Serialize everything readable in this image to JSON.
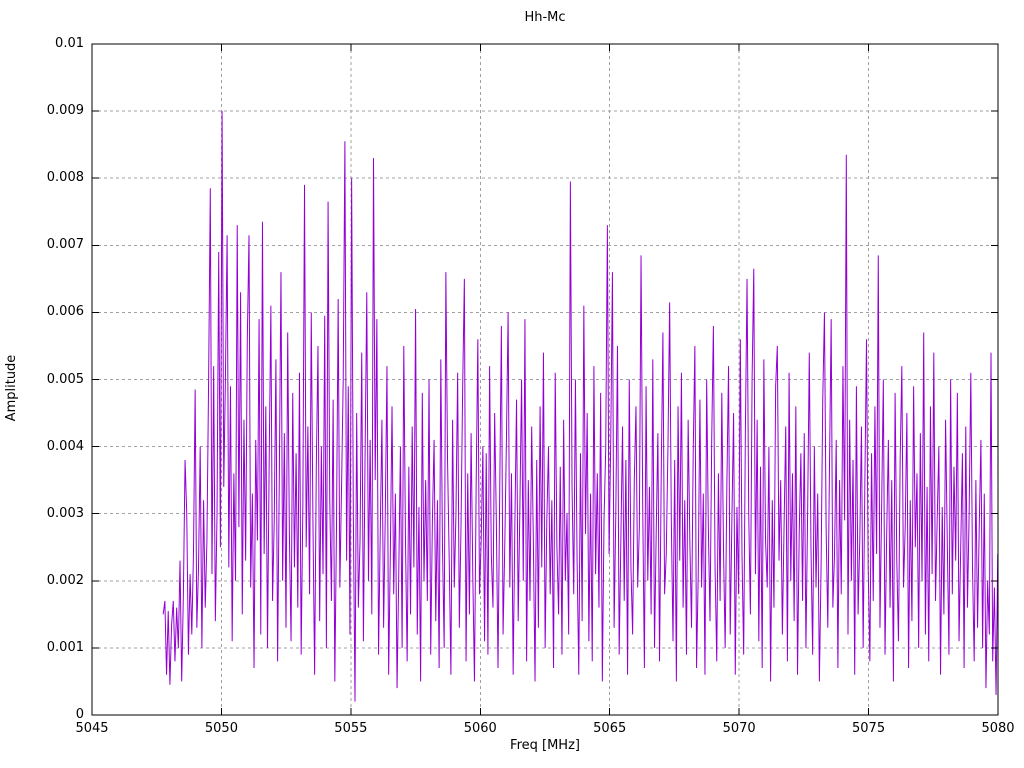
{
  "chart_data": {
    "type": "line",
    "title": "Hh-Mc",
    "xlabel": "Freq [MHz]",
    "ylabel": "Amplitude",
    "xlim": [
      5045,
      5080
    ],
    "ylim": [
      0,
      0.01
    ],
    "x_ticks": [
      5045,
      5050,
      5055,
      5060,
      5065,
      5070,
      5075,
      5080
    ],
    "x_tick_labels": [
      "5045",
      "5050",
      "5055",
      "5060",
      "5065",
      "5070",
      "5075",
      "5080"
    ],
    "y_ticks": [
      0,
      0.001,
      0.002,
      0.003,
      0.004,
      0.005,
      0.006,
      0.007,
      0.008,
      0.009,
      0.01
    ],
    "y_tick_labels": [
      "0",
      "0.001",
      "0.002",
      "0.003",
      "0.004",
      "0.005",
      "0.006",
      "0.007",
      "0.008",
      "0.009",
      "0.01"
    ],
    "grid": "dashed-gray",
    "legend": "none",
    "line_color": "#9400d3",
    "grid_color": "#a0a0a0",
    "axis_color": "#000000",
    "series": [
      {
        "name": "Hh-Mc",
        "freq_start": 5047.75,
        "freq_step": 0.065,
        "amplitude_scale": 0.001,
        "amplitudes": [
          1.5,
          1.7,
          0.6,
          1.55,
          0.45,
          1.35,
          1.7,
          0.8,
          1.6,
          1.0,
          2.3,
          0.5,
          1.8,
          3.8,
          3.0,
          0.9,
          2.1,
          1.2,
          2.4,
          4.85,
          1.3,
          2.2,
          4.0,
          1.0,
          3.2,
          1.6,
          2.6,
          5.0,
          7.85,
          2.1,
          5.2,
          1.4,
          3.0,
          6.9,
          2.5,
          9.0,
          3.4,
          5.05,
          7.15,
          2.2,
          4.9,
          1.1,
          3.6,
          2.0,
          7.3,
          2.8,
          6.3,
          1.5,
          4.4,
          2.3,
          5.6,
          7.15,
          1.9,
          3.3,
          0.7,
          4.1,
          2.6,
          5.9,
          1.2,
          7.35,
          2.4,
          4.6,
          1.0,
          3.8,
          6.1,
          1.7,
          2.9,
          5.3,
          0.8,
          3.5,
          6.6,
          2.0,
          4.2,
          1.3,
          5.7,
          2.7,
          1.1,
          4.8,
          2.2,
          3.9,
          1.6,
          5.1,
          0.9,
          3.1,
          7.9,
          2.5,
          4.3,
          1.8,
          6.0,
          2.9,
          0.6,
          3.7,
          5.5,
          1.4,
          4.0,
          2.1,
          5.95,
          1.0,
          7.65,
          3.2,
          1.7,
          4.7,
          0.5,
          2.8,
          6.2,
          1.9,
          3.4,
          5.0,
          8.55,
          2.3,
          4.9,
          1.2,
          8.0,
          3.0,
          0.2,
          4.5,
          1.6,
          2.6,
          5.4,
          1.1,
          3.9,
          6.3,
          2.0,
          4.1,
          1.5,
          8.3,
          3.5,
          5.9,
          0.9,
          2.7,
          4.4,
          1.3,
          3.0,
          5.2,
          0.6,
          2.4,
          4.6,
          1.8,
          3.3,
          0.4,
          2.1,
          4.0,
          1.0,
          5.5,
          2.6,
          0.8,
          3.7,
          1.5,
          4.3,
          2.2,
          6.05,
          1.2,
          3.1,
          0.5,
          4.8,
          2.0,
          3.5,
          1.7,
          5.0,
          0.9,
          2.9,
          4.1,
          1.4,
          3.2,
          0.7,
          5.3,
          2.5,
          1.0,
          6.6,
          3.8,
          2.3,
          0.6,
          4.4,
          1.9,
          3.0,
          5.1,
          1.3,
          2.8,
          4.9,
          6.5,
          0.8,
          3.6,
          1.5,
          4.2,
          2.1,
          0.5,
          3.4,
          5.6,
          1.8,
          2.6,
          4.0,
          1.1,
          3.9,
          0.9,
          5.2,
          2.4,
          1.6,
          4.5,
          2.9,
          0.7,
          3.3,
          5.8,
          1.2,
          2.5,
          4.1,
          6.0,
          1.9,
          3.6,
          0.6,
          2.8,
          4.7,
          1.4,
          3.1,
          5.0,
          2.0,
          5.9,
          0.8,
          3.5,
          1.7,
          4.3,
          2.6,
          0.5,
          3.8,
          1.3,
          4.6,
          2.2,
          5.4,
          1.0,
          2.9,
          4.0,
          1.8,
          3.2,
          0.7,
          5.1,
          2.5,
          1.5,
          3.7,
          0.9,
          4.4,
          2.0,
          3.0,
          1.2,
          7.95,
          3.4,
          1.8,
          5.0,
          2.3,
          0.6,
          3.9,
          1.4,
          6.1,
          2.7,
          4.5,
          1.1,
          3.3,
          0.8,
          5.2,
          2.1,
          3.6,
          1.6,
          4.8,
          0.5,
          2.9,
          3.95,
          7.3,
          2.4,
          4.1,
          6.6,
          1.3,
          3.0,
          5.5,
          0.9,
          2.6,
          4.3,
          1.7,
          3.8,
          0.6,
          5.0,
          2.2,
          1.2,
          3.5,
          4.6,
          1.9,
          2.8,
          6.85,
          3.1,
          0.7,
          4.9,
          2.0,
          3.4,
          1.5,
          5.3,
          1.0,
          2.7,
          4.2,
          0.8,
          3.6,
          5.7,
          1.8,
          2.4,
          4.0,
          6.15,
          2.9,
          1.1,
          3.8,
          0.5,
          4.6,
          2.3,
          5.1,
          1.6,
          3.2,
          0.9,
          4.4,
          2.6,
          1.3,
          3.9,
          5.5,
          0.7,
          2.1,
          4.7,
          1.9,
          3.3,
          0.6,
          5.0,
          2.8,
          1.4,
          4.1,
          5.8,
          2.2,
          0.8,
          3.6,
          1.7,
          4.8,
          2.5,
          1.0,
          3.4,
          5.2,
          1.2,
          2.9,
          4.5,
          0.6,
          3.1,
          1.8,
          5.6,
          2.4,
          0.9,
          4.2,
          6.5,
          3.0,
          1.5,
          5.0,
          6.65,
          2.1,
          4.4,
          1.1,
          3.7,
          0.7,
          5.3,
          2.6,
          1.9,
          4.0,
          0.5,
          3.2,
          1.6,
          4.9,
          5.5,
          2.3,
          3.5,
          1.2,
          2.8,
          4.3,
          0.8,
          5.1,
          2.0,
          3.6,
          1.4,
          4.6,
          0.6,
          2.7,
          3.9,
          1.7,
          4.2,
          1.0,
          3.0,
          5.4,
          2.5,
          0.9,
          4.0,
          1.9,
          3.3,
          0.5,
          2.2,
          4.7,
          6.0,
          2.8,
          1.3,
          3.7,
          5.9,
          1.6,
          2.4,
          4.1,
          0.7,
          3.5,
          1.8,
          5.2,
          2.9,
          8.35,
          1.2,
          4.4,
          2.0,
          3.8,
          0.6,
          4.9,
          1.5,
          2.6,
          4.3,
          1.0,
          3.4,
          5.6,
          2.2,
          0.8,
          3.9,
          1.7,
          4.6,
          2.4,
          6.85,
          1.3,
          3.1,
          5.0,
          0.9,
          2.7,
          4.1,
          1.6,
          3.5,
          0.5,
          4.8,
          2.3,
          1.1,
          3.8,
          5.2,
          1.9,
          2.8,
          4.5,
          0.7,
          3.2,
          1.4,
          4.9,
          2.5,
          3.6,
          1.0,
          4.2,
          2.0,
          5.7,
          1.2,
          3.4,
          0.8,
          4.6,
          2.1,
          5.4,
          1.7,
          2.9,
          4.0,
          0.6,
          3.1,
          1.5,
          4.4,
          2.6,
          0.9,
          5.0,
          1.8,
          3.7,
          2.3,
          4.8,
          1.1,
          2.5,
          3.9,
          0.7,
          4.3,
          1.6,
          3.0,
          5.1,
          2.2,
          0.8,
          3.5,
          1.3,
          2.8,
          4.1,
          1.0,
          3.3,
          0.4,
          2.0,
          1.2,
          5.4,
          0.8,
          1.9,
          0.3,
          2.4
        ]
      }
    ]
  }
}
